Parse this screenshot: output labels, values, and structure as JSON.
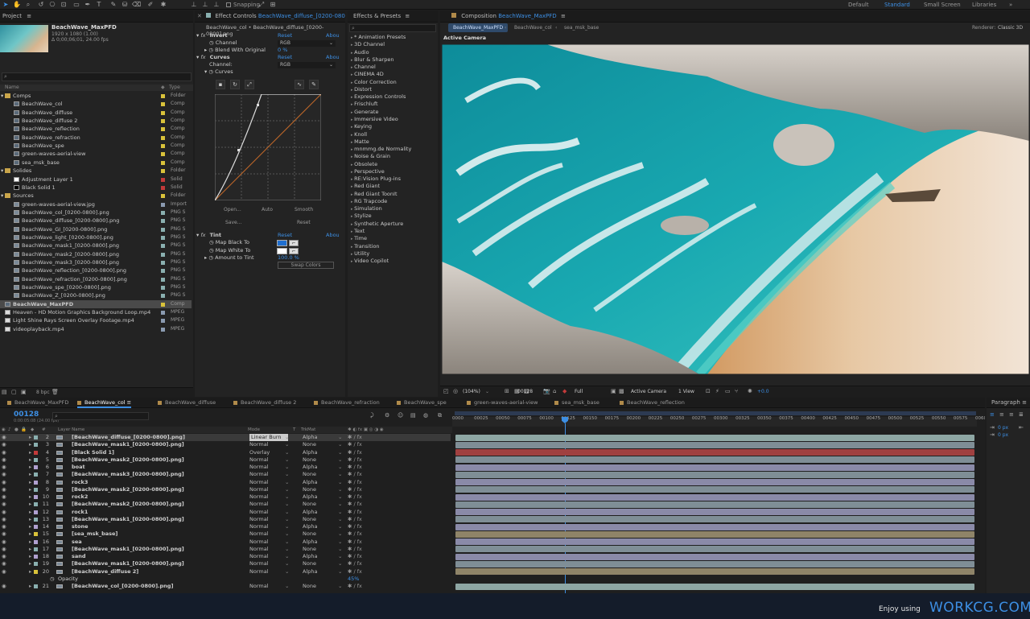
{
  "toolbar": {
    "snapping": "Snapping",
    "workspaces": [
      "Default",
      "Standard",
      "Small Screen",
      "Libraries"
    ]
  },
  "project": {
    "tab": "Project",
    "comp_name": "BeachWave_MaxPFD",
    "comp_info1": "1920 x 1080 (1.00)",
    "comp_info2": "Δ 0;00;06;01, 24.00 fps",
    "col_name": "Name",
    "col_type": "Type",
    "bpc": "8 bpc",
    "items": [
      {
        "name": "Comps",
        "type": "Folder",
        "indent": 0,
        "kind": "folder",
        "color": "#d9c23a"
      },
      {
        "name": "BeachWave_col",
        "type": "Comp",
        "indent": 1,
        "kind": "comp",
        "color": "#d9c23a"
      },
      {
        "name": "BeachWave_diffuse",
        "type": "Comp",
        "indent": 1,
        "kind": "comp",
        "color": "#d9c23a"
      },
      {
        "name": "BeachWave_diffuse 2",
        "type": "Comp",
        "indent": 1,
        "kind": "comp",
        "color": "#d9c23a"
      },
      {
        "name": "BeachWave_reflection",
        "type": "Comp",
        "indent": 1,
        "kind": "comp",
        "color": "#d9c23a"
      },
      {
        "name": "BeachWave_refraction",
        "type": "Comp",
        "indent": 1,
        "kind": "comp",
        "color": "#d9c23a"
      },
      {
        "name": "BeachWave_spe",
        "type": "Comp",
        "indent": 1,
        "kind": "comp",
        "color": "#d9c23a"
      },
      {
        "name": "green-waves-aerial-view",
        "type": "Comp",
        "indent": 1,
        "kind": "comp",
        "color": "#d9c23a"
      },
      {
        "name": "sea_msk_base",
        "type": "Comp",
        "indent": 1,
        "kind": "comp",
        "color": "#d9c23a"
      },
      {
        "name": "Solides",
        "type": "Folder",
        "indent": 0,
        "kind": "folder",
        "color": "#d9c23a"
      },
      {
        "name": "Adjustment Layer 1",
        "type": "Solid",
        "indent": 1,
        "kind": "solidw",
        "color": "#c23a3a"
      },
      {
        "name": "Black Solid 1",
        "type": "Solid",
        "indent": 1,
        "kind": "solidb",
        "color": "#c23a3a"
      },
      {
        "name": "Sources",
        "type": "Folder",
        "indent": 0,
        "kind": "folder",
        "color": "#d9c23a"
      },
      {
        "name": "green-waves-aerial-view.jpg",
        "type": "Import",
        "indent": 1,
        "kind": "img",
        "color": "#8a9ab0"
      },
      {
        "name": "BeachWave_col_[0200-0800].png",
        "type": "PNG S",
        "indent": 1,
        "kind": "img",
        "color": "#8ab0b0"
      },
      {
        "name": "BeachWave_diffuse_[0200-0800].png",
        "type": "PNG S",
        "indent": 1,
        "kind": "img",
        "color": "#8ab0b0"
      },
      {
        "name": "BeachWave_GI_[0200-0800].png",
        "type": "PNG S",
        "indent": 1,
        "kind": "img",
        "color": "#8ab0b0"
      },
      {
        "name": "BeachWave_light_[0200-0800].png",
        "type": "PNG S",
        "indent": 1,
        "kind": "img",
        "color": "#8ab0b0"
      },
      {
        "name": "BeachWave_mask1_[0200-0800].png",
        "type": "PNG S",
        "indent": 1,
        "kind": "img",
        "color": "#8ab0b0"
      },
      {
        "name": "BeachWave_mask2_[0200-0800].png",
        "type": "PNG S",
        "indent": 1,
        "kind": "img",
        "color": "#8ab0b0"
      },
      {
        "name": "BeachWave_mask3_[0200-0800].png",
        "type": "PNG S",
        "indent": 1,
        "kind": "img",
        "color": "#8ab0b0"
      },
      {
        "name": "BeachWave_reflection_[0200-0800].png",
        "type": "PNG S",
        "indent": 1,
        "kind": "img",
        "color": "#8ab0b0"
      },
      {
        "name": "BeachWave_refraction_[0200-0800].png",
        "type": "PNG S",
        "indent": 1,
        "kind": "img",
        "color": "#8ab0b0"
      },
      {
        "name": "BeachWave_spe_[0200-0800].png",
        "type": "PNG S",
        "indent": 1,
        "kind": "img",
        "color": "#8ab0b0"
      },
      {
        "name": "BeachWave_Z_[0200-0800].png",
        "type": "PNG S",
        "indent": 1,
        "kind": "img",
        "color": "#8ab0b0"
      },
      {
        "name": "BeachWave_MaxPFD",
        "type": "Comp",
        "indent": 0,
        "kind": "comp",
        "color": "#d9c23a",
        "selected": true
      },
      {
        "name": "Heaven - HD Motion Graphics Background Loop.mp4",
        "type": "MPEG",
        "indent": 0,
        "kind": "video",
        "color": "#8a9ab0"
      },
      {
        "name": "Light Shine Rays Screen Overlay Footage.mp4",
        "type": "MPEG",
        "indent": 0,
        "kind": "video",
        "color": "#8a9ab0"
      },
      {
        "name": "videoplayback.mp4",
        "type": "MPEG",
        "indent": 0,
        "kind": "video",
        "color": "#8a9ab0"
      }
    ]
  },
  "effect_controls": {
    "tab_prefix": "Effect Controls",
    "tab_file": "BeachWave_diffuse_[0200-0800].png",
    "breadcrumb": "BeachWave_col • BeachWave_diffuse_[0200-0800].png",
    "invert": {
      "name": "Invert",
      "reset": "Reset",
      "about": "Abou",
      "channel_label": "Channel",
      "channel_value": "RGB",
      "blend_label": "Blend With Original",
      "blend_value": "0 %"
    },
    "curves": {
      "name": "Curves",
      "reset": "Reset",
      "about": "Abou",
      "channel_label": "Channel:",
      "channel_value": "RGB",
      "curves_label": "Curves",
      "open": "Open...",
      "auto": "Auto",
      "smooth": "Smooth",
      "save": "Save...",
      "reset2": "Reset"
    },
    "tint": {
      "name": "Tint",
      "reset": "Reset",
      "about": "Abou",
      "black_label": "Map Black To",
      "white_label": "Map White To",
      "amount_label": "Amount to Tint",
      "amount_value": "100.0 %",
      "swap": "Swap Colors"
    }
  },
  "effects": {
    "tab": "Effects & Presets",
    "list": [
      "* Animation Presets",
      "3D Channel",
      "Audio",
      "Blur & Sharpen",
      "Channel",
      "CINEMA 4D",
      "Color Correction",
      "Distort",
      "Expression Controls",
      "Frischluft",
      "Generate",
      "Immersive Video",
      "Keying",
      "Knoll",
      "Matte",
      "mnmmg.de Normality",
      "Noise & Grain",
      "Obsolete",
      "Perspective",
      "RE:Vision Plug-ins",
      "Red Giant",
      "Red Giant ToonIt",
      "RG Trapcode",
      "Simulation",
      "Stylize",
      "Synthetic Aperture",
      "Text",
      "Time",
      "Transition",
      "Utility",
      "Video Copilot"
    ]
  },
  "composition": {
    "tab_prefix": "Composition",
    "tab_name": "BeachWave_MaxPFD",
    "sub_tabs": [
      "BeachWave_MaxPFD",
      "BeachWave_col",
      "sea_msk_base"
    ],
    "renderer_label": "Renderer:",
    "renderer_value": "Classic 3D",
    "active_camera": "Active Camera",
    "footer": {
      "zoom": "(104%)",
      "timecode": "00128",
      "res": "Full",
      "camera": "Active Camera",
      "views": "1 View",
      "exposure": "+0.0"
    }
  },
  "timeline": {
    "tabs": [
      "BeachWave_MaxPFD",
      "BeachWave_col",
      "BeachWave_diffuse",
      "BeachWave_diffuse 2",
      "BeachWave_refraction",
      "BeachWave_spe",
      "green-waves-aerial-view",
      "sea_msk_base",
      "BeachWave_reflection"
    ],
    "current_time": "00128",
    "fps_info": "0:00:05:08 (24.00 fps)",
    "col_layer": "Layer Name",
    "col_mode": "Mode",
    "col_t": "T",
    "col_trkmat": "TrkMat",
    "ticks": [
      "0000",
      "00025",
      "00050",
      "00075",
      "00100",
      "00125",
      "00150",
      "00175",
      "00200",
      "00225",
      "00250",
      "00275",
      "00300",
      "00325",
      "00350",
      "00375",
      "00400",
      "00425",
      "00450",
      "00475",
      "00500",
      "00525",
      "00550",
      "00575",
      "0060"
    ],
    "layers": [
      {
        "num": "2",
        "name": "[BeachWave_diffuse_[0200-0800].png]",
        "mode": "Linear Burn",
        "trk": "Alpha",
        "color": "#8ab0b0",
        "bar": "#8ea7a4",
        "selected": true
      },
      {
        "num": "3",
        "name": "[BeachWave_mask1_[0200-0800].png]",
        "mode": "Normal",
        "trk": "None",
        "color": "#8ab0b0",
        "bar": "#7f8e96"
      },
      {
        "num": "4",
        "name": "[Black Solid 1]",
        "mode": "Overlay",
        "trk": "Alpha",
        "color": "#c23a3a",
        "bar": "#a04040"
      },
      {
        "num": "5",
        "name": "[BeachWave_mask2_[0200-0800].png]",
        "mode": "Normal",
        "trk": "None",
        "color": "#8ab0b0",
        "bar": "#7f8e96"
      },
      {
        "num": "6",
        "name": "boat",
        "mode": "Normal",
        "trk": "Alpha",
        "color": "#b0a0d0",
        "bar": "#8a8aa8"
      },
      {
        "num": "7",
        "name": "[BeachWave_mask3_[0200-0800].png]",
        "mode": "Normal",
        "trk": "None",
        "color": "#8ab0b0",
        "bar": "#7f8e96"
      },
      {
        "num": "8",
        "name": "rock3",
        "mode": "Normal",
        "trk": "Alpha",
        "color": "#b0a0d0",
        "bar": "#8a8aa8"
      },
      {
        "num": "9",
        "name": "[BeachWave_mask2_[0200-0800].png]",
        "mode": "Normal",
        "trk": "None",
        "color": "#8ab0b0",
        "bar": "#7f8e96"
      },
      {
        "num": "10",
        "name": "rock2",
        "mode": "Normal",
        "trk": "Alpha",
        "color": "#b0a0d0",
        "bar": "#8a8aa8"
      },
      {
        "num": "11",
        "name": "[BeachWave_mask2_[0200-0800].png]",
        "mode": "Normal",
        "trk": "None",
        "color": "#8ab0b0",
        "bar": "#7f8e96"
      },
      {
        "num": "12",
        "name": "rock1",
        "mode": "Normal",
        "trk": "Alpha",
        "color": "#b0a0d0",
        "bar": "#8a8aa8"
      },
      {
        "num": "13",
        "name": "[BeachWave_mask1_[0200-0800].png]",
        "mode": "Normal",
        "trk": "None",
        "color": "#8ab0b0",
        "bar": "#7f8e96"
      },
      {
        "num": "14",
        "name": "stone",
        "mode": "Normal",
        "trk": "Alpha",
        "color": "#b0a0d0",
        "bar": "#8a8aa8"
      },
      {
        "num": "15",
        "name": "[sea_msk_base]",
        "mode": "Normal",
        "trk": "None",
        "color": "#d9c23a",
        "bar": "#8f8468"
      },
      {
        "num": "16",
        "name": "sea",
        "mode": "Normal",
        "trk": "Alpha",
        "color": "#b0a0d0",
        "bar": "#8a8aa8"
      },
      {
        "num": "17",
        "name": "[BeachWave_mask1_[0200-0800].png]",
        "mode": "Normal",
        "trk": "None",
        "color": "#8ab0b0",
        "bar": "#7f8e96"
      },
      {
        "num": "18",
        "name": "sand",
        "mode": "Normal",
        "trk": "Alpha",
        "color": "#b0a0d0",
        "bar": "#8a8aa8"
      },
      {
        "num": "19",
        "name": "[BeachWave_mask1_[0200-0800].png]",
        "mode": "Normal",
        "trk": "None",
        "color": "#8ab0b0",
        "bar": "#7f8e96"
      },
      {
        "num": "20",
        "name": "[BeachWave_diffuse 2]",
        "mode": "Normal",
        "trk": "Alpha",
        "color": "#d9c23a",
        "bar": "#8f8468"
      },
      {
        "num": "",
        "name": "Opacity",
        "mode": "",
        "trk": "",
        "color": "",
        "bar": "",
        "sub": true,
        "value": "45%"
      },
      {
        "num": "21",
        "name": "[BeachWave_col_[0200-0800].png]",
        "mode": "Normal",
        "trk": "None",
        "color": "#8ab0b0",
        "bar": "#8ea7a4"
      }
    ]
  },
  "paragraph": {
    "tab": "Paragraph",
    "v1": "0 px",
    "v2": "0 px"
  },
  "watermark": {
    "prefix": "Enjoy using",
    "brand": "WORKCG.COM"
  }
}
